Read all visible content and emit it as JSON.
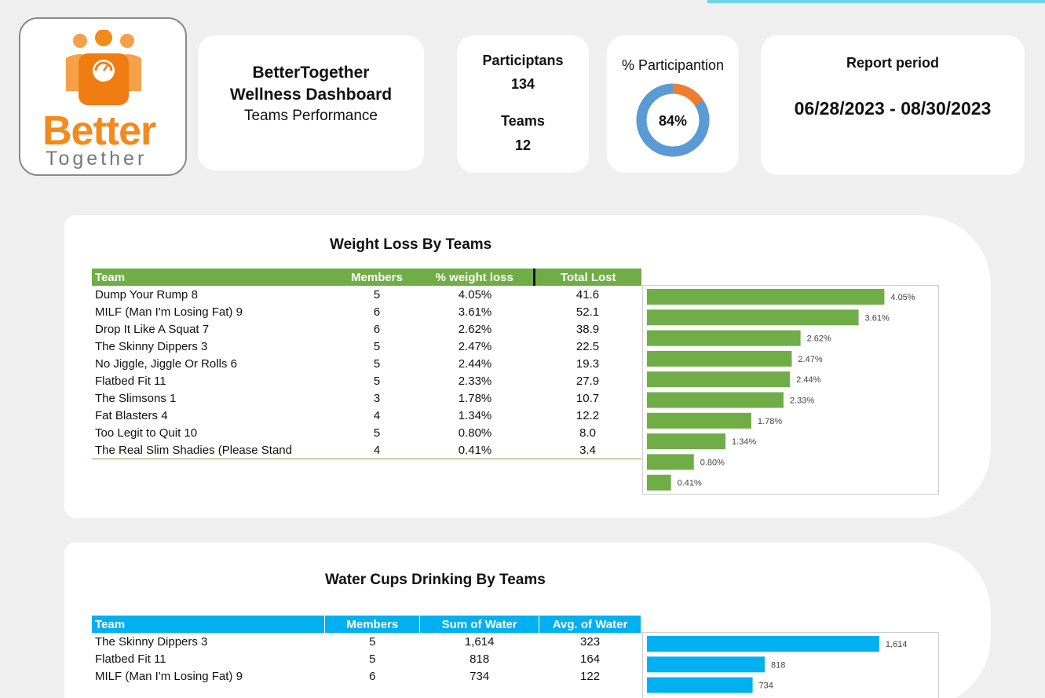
{
  "header": {
    "logo": {
      "word1": "Better",
      "word2": "Together"
    },
    "title_line1": "BetterTogether",
    "title_line2": "Wellness Dashboard",
    "subtitle": "Teams Performance",
    "participants_label": "Participtans",
    "participants_value": "134",
    "teams_label": "Teams",
    "teams_value": "12",
    "participation_title": "% Participantion",
    "participation_text": "84%",
    "participation_fraction": 0.84,
    "report_title": "Report period",
    "report_value": "06/28/2023 - 08/30/2023"
  },
  "colors": {
    "green": "#70ad47",
    "blue": "#00b0f0",
    "donut_main": "#5b9bd5",
    "donut_rest": "#ed7d31",
    "logo_orange": "#f28a1e"
  },
  "weight": {
    "title": "Weight Loss By Teams",
    "columns": [
      "Team",
      "Members",
      "% weight loss",
      "Total Lost"
    ],
    "rows": [
      [
        "Dump Your Rump 8",
        "5",
        "4.05%",
        "41.6"
      ],
      [
        "MILF (Man I'm Losing Fat) 9",
        "6",
        "3.61%",
        "52.1"
      ],
      [
        "Drop It Like A Squat 7",
        "6",
        "2.62%",
        "38.9"
      ],
      [
        "The Skinny Dippers 3",
        "5",
        "2.47%",
        "22.5"
      ],
      [
        "No Jiggle, Jiggle Or Rolls 6",
        "5",
        "2.44%",
        "19.3"
      ],
      [
        "Flatbed Fit 11",
        "5",
        "2.33%",
        "27.9"
      ],
      [
        "The Slimsons 1",
        "3",
        "1.78%",
        "10.7"
      ],
      [
        "Fat Blasters 4",
        "4",
        "1.34%",
        "12.2"
      ],
      [
        "Too Legit to Quit 10",
        "5",
        "0.80%",
        "8.0"
      ],
      [
        "The Real Slim Shadies (Please Stand",
        "4",
        "0.41%",
        "3.4"
      ]
    ]
  },
  "water": {
    "title": "Water Cups Drinking By Teams",
    "columns": [
      "Team",
      "Members",
      "Sum of Water",
      "Avg. of Water"
    ],
    "rows": [
      [
        "The Skinny Dippers 3",
        "5",
        "1,614",
        "323"
      ],
      [
        "Flatbed Fit 11",
        "5",
        "818",
        "164"
      ],
      [
        "MILF (Man I'm Losing Fat) 9",
        "6",
        "734",
        "122"
      ]
    ]
  },
  "chart_data": [
    {
      "type": "bar",
      "orientation": "horizontal",
      "categories": [
        "Dump Your Rump 8",
        "MILF (Man I'm Losing Fat) 9",
        "Drop It Like A Squat 7",
        "The Skinny Dippers 3",
        "No Jiggle, Jiggle Or Rolls 6",
        "Flatbed Fit 11",
        "The Slimsons 1",
        "Fat Blasters 4",
        "Too Legit to Quit 10",
        "The Real Slim Shadies (Please Stand"
      ],
      "values": [
        4.05,
        3.61,
        2.62,
        2.47,
        2.44,
        2.33,
        1.78,
        1.34,
        0.8,
        0.41
      ],
      "labels": [
        "4.05%",
        "3.61%",
        "2.62%",
        "2.47%",
        "2.44%",
        "2.33%",
        "1.78%",
        "1.34%",
        "0.80%",
        "0.41%"
      ],
      "xlim": [
        0,
        4.5
      ],
      "grid": false,
      "color": "#70ad47"
    },
    {
      "type": "bar",
      "orientation": "horizontal",
      "categories": [
        "The Skinny Dippers 3",
        "Flatbed Fit 11",
        "MILF (Man I'm Losing Fat) 9"
      ],
      "values": [
        1614,
        818,
        734
      ],
      "labels": [
        "1,614",
        "818",
        "734"
      ],
      "xlim": [
        0,
        1800
      ],
      "grid": false,
      "color": "#00b0f0"
    }
  ]
}
